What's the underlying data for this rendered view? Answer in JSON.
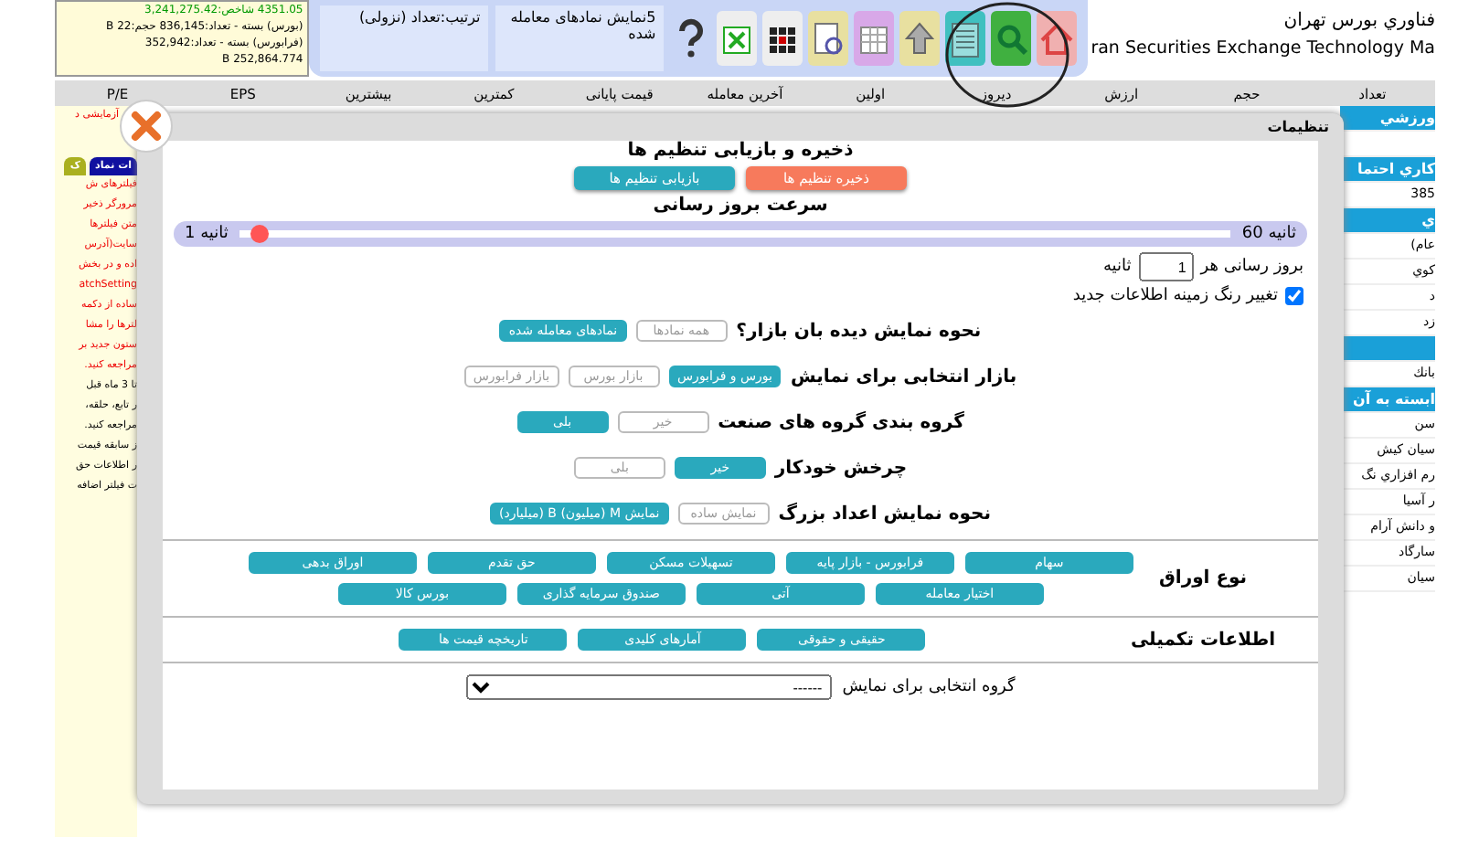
{
  "header": {
    "market_info": [
      "4351.05 شاخص:3,241,275.42",
      "(بورس) بسته - تعداد:836,145 حجم:B 22",
      "(فرابورس) بسته - تعداد:352,942",
      "252,864.774 B"
    ],
    "sort_label": "ترتیب:تعداد (نزولی)",
    "display_label": "5نمایش نمادهای معامله شده",
    "title_fa": "فناوري بورس تهران",
    "title_en": "ran Securities Exchange Technology Ma"
  },
  "columns": [
    "تعداد",
    "حجم",
    "ارزش",
    "دیروز",
    "اولین",
    "آخرین معامله",
    "قیمت پایانی",
    "کمترین",
    "بیشترین",
    "EPS",
    "P/E"
  ],
  "left_panel": {
    "notice": "آزمایشی د",
    "tabs": [
      {
        "label": "ات نماد",
        "selected": true
      },
      {
        "label": "ک",
        "selected": false
      }
    ],
    "lines": [
      {
        "text": "فیلترهای ش",
        "kind": "alert"
      },
      {
        "text": "مرورگر ذخیر",
        "kind": "alert"
      },
      {
        "text": "متن فیلترها",
        "kind": "alert"
      },
      {
        "text": "سایت(آدرس",
        "kind": "alert"
      },
      {
        "text": "اده و در بخش",
        "kind": "alert"
      },
      {
        "text": "atchSetting",
        "kind": "alert"
      },
      {
        "text": "ساده از دکمه",
        "kind": "alert"
      },
      {
        "text": "لترها را مشا",
        "kind": "alert"
      },
      {
        "text": "ستون جدید بر",
        "kind": "note"
      },
      {
        "text": "مراجعه کنید.",
        "kind": "note"
      },
      {
        "text": "تا 3 ماه قبل",
        "kind": "plain"
      },
      {
        "text": "ر تابع، حلقه،",
        "kind": "plain"
      },
      {
        "text": "مراجعه کنید.",
        "kind": "plain"
      },
      {
        "text": "ز سابقه قیمت",
        "kind": "plain"
      },
      {
        "text": "ر اطلاعات حق",
        "kind": "plain"
      },
      {
        "text": "ت فیلتر اضافه",
        "kind": "plain"
      }
    ]
  },
  "right_panel": [
    {
      "kind": "heading",
      "text": "ورزشي"
    },
    {
      "kind": "row"
    },
    {
      "kind": "heading",
      "text": "کاري احتما"
    },
    {
      "kind": "row",
      "text": "385"
    },
    {
      "kind": "heading",
      "text": "ي"
    },
    {
      "kind": "row",
      "text": "عام)"
    },
    {
      "kind": "row",
      "text": "کوي"
    },
    {
      "kind": "row",
      "text": "د"
    },
    {
      "kind": "row",
      "text": "زد"
    },
    {
      "kind": "heading"
    },
    {
      "kind": "row",
      "text": "بانك"
    },
    {
      "kind": "heading",
      "text": "ابسته به آن"
    },
    {
      "kind": "row",
      "text": "سن"
    },
    {
      "kind": "row",
      "text": "سیان کیش"
    },
    {
      "kind": "row",
      "text": "رم افزاري نگ"
    },
    {
      "kind": "row",
      "text": "ر آسیا"
    },
    {
      "kind": "row",
      "text": "و دانش آرام"
    },
    {
      "kind": "row",
      "text": "سارگاد"
    },
    {
      "kind": "row",
      "text": "سیان"
    }
  ],
  "dialog": {
    "title": "تنظیمات",
    "save_heading": "ذخیره و بازیابی تنظیم ها",
    "save_button": "ذخیره تنظیم ها",
    "restore_button": "بازیابی تنظیم ها",
    "speed_heading": "سرعت بروز رسانی",
    "slider": {
      "max_label": "ثانیه 60",
      "min_label": "ثانیه 1",
      "level": 0.02
    },
    "interval": {
      "before": "بروز رسانی هر",
      "value": "1",
      "after": "ثانیه"
    },
    "highlight": {
      "label": "تغییر رنگ زمینه اطلاعات جدید",
      "checked": true
    },
    "options": [
      {
        "label": "نحوه نمایش دیده بان بازار؟",
        "choices": [
          {
            "label": "همه نمادها",
            "selected": false
          },
          {
            "label": "نمادهای معامله شده",
            "selected": true
          }
        ]
      },
      {
        "label": "بازار انتخابی برای نمایش",
        "choices": [
          {
            "label": "بورس و فرابورس",
            "selected": true
          },
          {
            "label": "بازار بورس",
            "selected": false
          },
          {
            "label": "بازار فرابورس",
            "selected": false
          }
        ]
      },
      {
        "label": "گروه بندی گروه های صنعت",
        "choices": [
          {
            "label": "خیر",
            "selected": false
          },
          {
            "label": "بلی",
            "selected": true
          }
        ]
      },
      {
        "label": "چرخش خودکار",
        "choices": [
          {
            "label": "خیر",
            "selected": true
          },
          {
            "label": "بلی",
            "selected": false
          }
        ]
      },
      {
        "label": "نحوه نمایش اعداد بزرگ",
        "choices": [
          {
            "label": "نمایش ساده",
            "selected": false
          },
          {
            "label": "نمایش M (میلیون) B (میلیارد)",
            "selected": true
          }
        ]
      }
    ],
    "types": {
      "label": "نوع اوراق",
      "items": [
        {
          "label": "سهام",
          "selected": true
        },
        {
          "label": "فرابورس - بازار پایه",
          "selected": true
        },
        {
          "label": "تسهیلات مسکن",
          "selected": true
        },
        {
          "label": "حق تقدم",
          "selected": true
        },
        {
          "label": "اوراق بدهی",
          "selected": true
        },
        {
          "label": "اختیار معامله",
          "selected": true
        },
        {
          "label": "آتی",
          "selected": true
        },
        {
          "label": "صندوق سرمایه گذاری",
          "selected": true
        },
        {
          "label": "بورس کالا",
          "selected": true
        }
      ]
    },
    "extras": {
      "label": "اطلاعات تکمیلی",
      "items": [
        {
          "label": "حقیقی و حقوقی",
          "selected": true
        },
        {
          "label": "آمارهای کلیدی",
          "selected": true
        },
        {
          "label": "تاریخچه قیمت ها",
          "selected": true
        }
      ]
    },
    "group": {
      "label": "گروه انتخابی برای نمایش",
      "value": "------"
    }
  }
}
